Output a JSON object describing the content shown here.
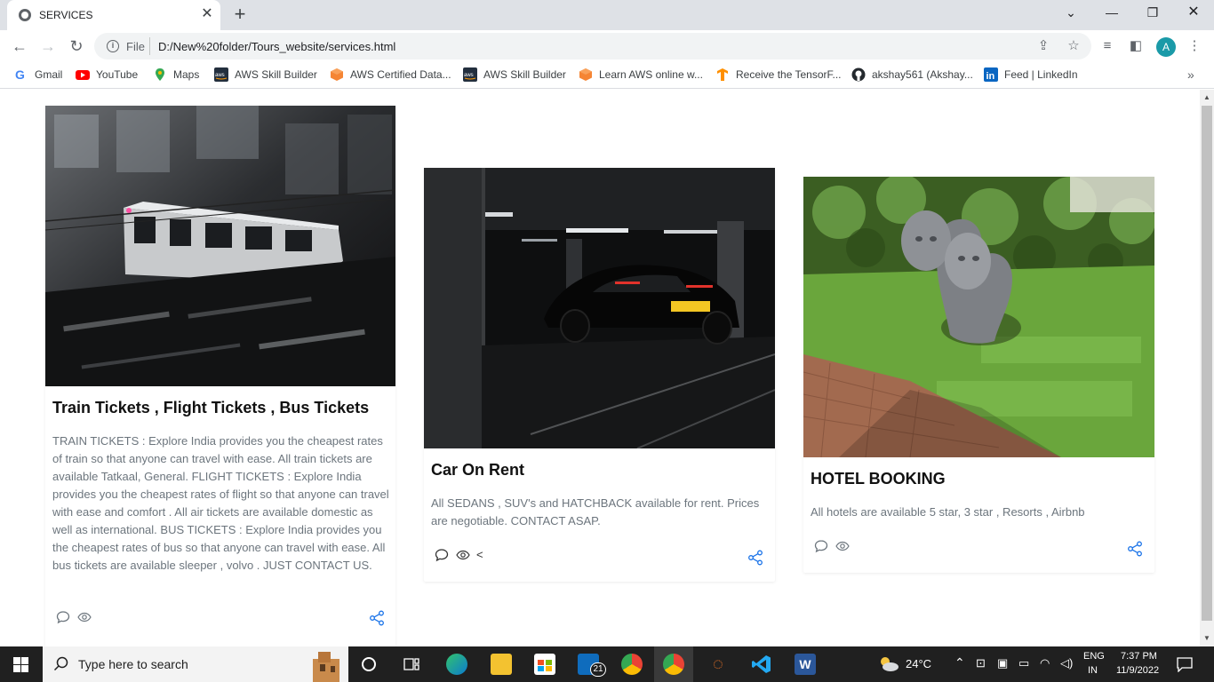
{
  "browser": {
    "tab_title": "SERVICES",
    "tab_close": "✕",
    "new_tab": "+",
    "url_scheme": "File",
    "url": "D:/New%20folder/Tours_website/services.html",
    "profile_initial": "A",
    "bookmarks": [
      {
        "label": "Gmail",
        "icon": "gmail-icon",
        "color": "#ea4335"
      },
      {
        "label": "YouTube",
        "icon": "youtube-icon",
        "color": "#ff0000"
      },
      {
        "label": "Maps",
        "icon": "maps-icon",
        "color": "#34a853"
      },
      {
        "label": "AWS Skill Builder",
        "icon": "aws-icon",
        "color": "#232f3e"
      },
      {
        "label": "AWS Certified Data...",
        "icon": "aws-cube-icon",
        "color": "#f58534"
      },
      {
        "label": "AWS Skill Builder",
        "icon": "aws-icon",
        "color": "#232f3e"
      },
      {
        "label": "Learn AWS online w...",
        "icon": "aws-cube-icon",
        "color": "#f58534"
      },
      {
        "label": "Receive the TensorF...",
        "icon": "tensorflow-icon",
        "color": "#ff8f00"
      },
      {
        "label": "akshay561 (Akshay...",
        "icon": "github-icon",
        "color": "#24292e"
      },
      {
        "label": "Feed | LinkedIn",
        "icon": "linkedin-icon",
        "color": "#0a66c2"
      }
    ]
  },
  "cards": [
    {
      "title": "Train Tickets , Flight Tickets , Bus Tickets",
      "text": "TRAIN TICKETS : Explore India provides you the cheapest rates of train so that anyone can travel with ease. All train tickets are available Tatkaal, General. FLIGHT TICKETS : Explore India provides you the cheapest rates of flight so that anyone can travel with ease and comfort . All air tickets are available domestic as well as international. BUS TICKETS : Explore India provides you the cheapest rates of bus so that anyone can travel with ease. All bus tickets are available sleeper , volvo . JUST CONTACT US."
    },
    {
      "title": "Car On Rent",
      "text": "All SEDANS , SUV's and HATCHBACK available for rent. Prices are negotiable. CONTACT ASAP.",
      "extra_char": "<"
    },
    {
      "title": "HOTEL BOOKING",
      "text": "All hotels are available 5 star, 3 star , Resorts , Airbnb"
    }
  ],
  "taskbar": {
    "search_placeholder": "Type here to search",
    "weather": "24°C",
    "language_line1": "ENG",
    "language_line2": "IN",
    "time": "7:37 PM",
    "date": "11/9/2022",
    "mail_badge": "21"
  },
  "colors": {
    "accent_blue": "#1a73e8",
    "text_muted": "#6c757d",
    "tabstrip": "#dee1e6",
    "taskbar": "#202020"
  }
}
